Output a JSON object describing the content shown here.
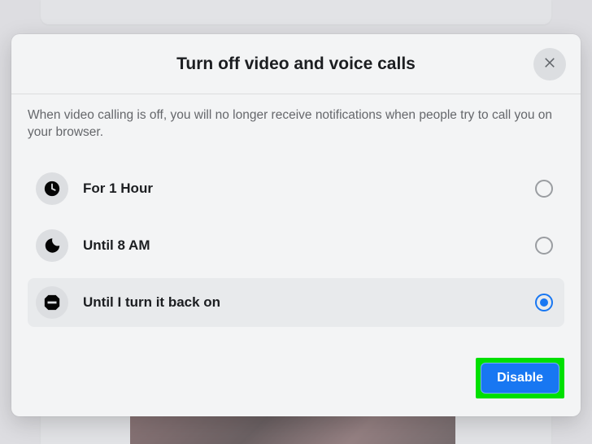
{
  "modal": {
    "title": "Turn off video and voice calls",
    "description": "When video calling is off, you will no longer receive notifications when people try to call you on your browser.",
    "options": [
      {
        "icon": "clock-icon",
        "label": "For 1 Hour",
        "selected": false
      },
      {
        "icon": "moon-icon",
        "label": "Until 8 AM",
        "selected": false
      },
      {
        "icon": "stop-icon",
        "label": "Until I turn it back on",
        "selected": true
      }
    ],
    "primary_action": "Disable",
    "close_label": "Close"
  },
  "colors": {
    "accent": "#1877f2",
    "highlight": "#00e000"
  }
}
